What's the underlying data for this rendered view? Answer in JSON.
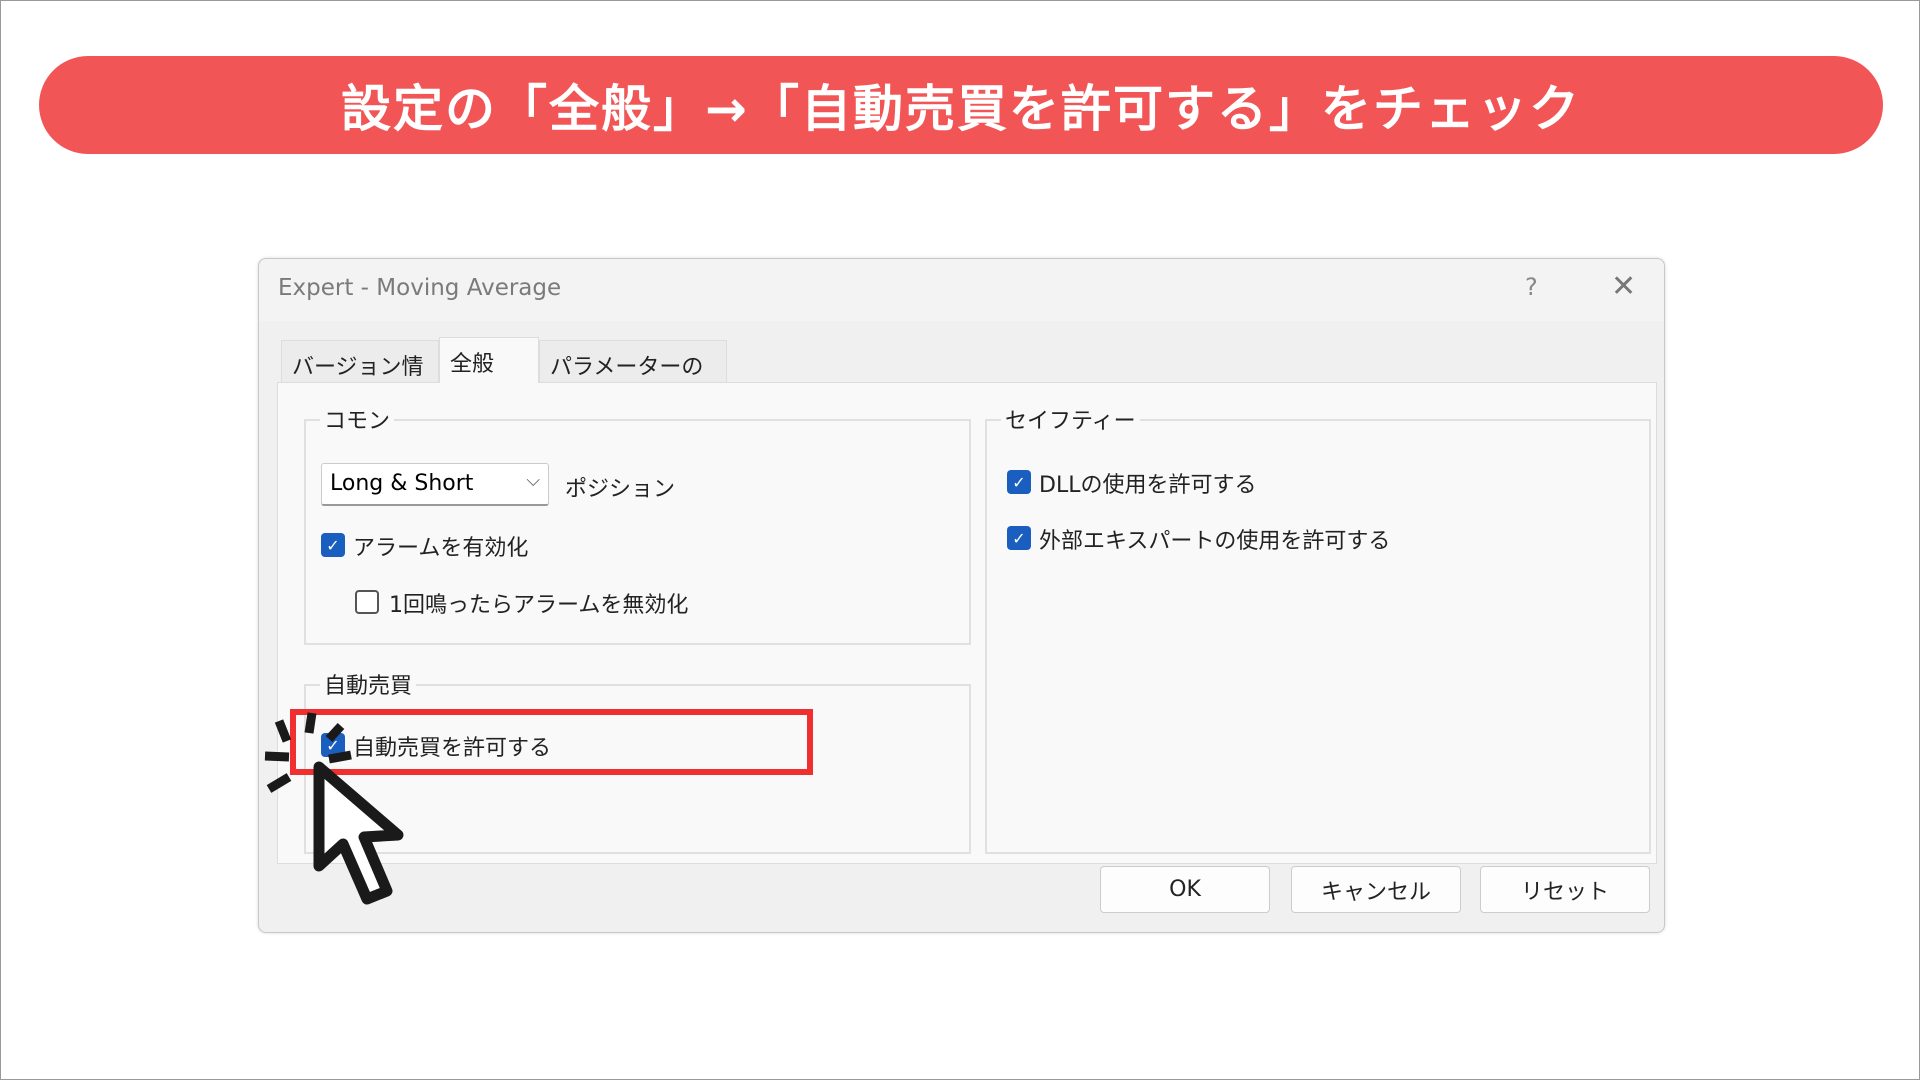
{
  "banner": {
    "text": "設定の「全般」→「自動売買を許可する」をチェック"
  },
  "dialog": {
    "title": "Expert - Moving Average",
    "help_label": "?",
    "tabs": [
      {
        "label": "バージョン情報"
      },
      {
        "label": "全般",
        "active": true
      },
      {
        "label": "パラメーターの入力"
      }
    ],
    "common": {
      "label": "コモン",
      "position_select": "Long & Short",
      "position_label": "ポジション",
      "alarm": {
        "label": "アラームを有効化",
        "checked": true
      },
      "alarm_once": {
        "label": "1回鳴ったらアラームを無効化",
        "checked": false
      }
    },
    "auto_trade": {
      "label": "自動売買",
      "allow": {
        "label": "自動売買を許可する",
        "checked": true
      }
    },
    "safety": {
      "label": "セイフティー",
      "dll": {
        "label": "DLLの使用を許可する",
        "checked": true
      },
      "external": {
        "label": "外部エキスパートの使用を許可する",
        "checked": true
      }
    },
    "buttons": {
      "ok": "OK",
      "cancel": "キャンセル",
      "reset": "リセット"
    }
  },
  "colors": {
    "banner": "#f25555",
    "highlight": "#f03030",
    "checkbox": "#1a5fc0"
  }
}
